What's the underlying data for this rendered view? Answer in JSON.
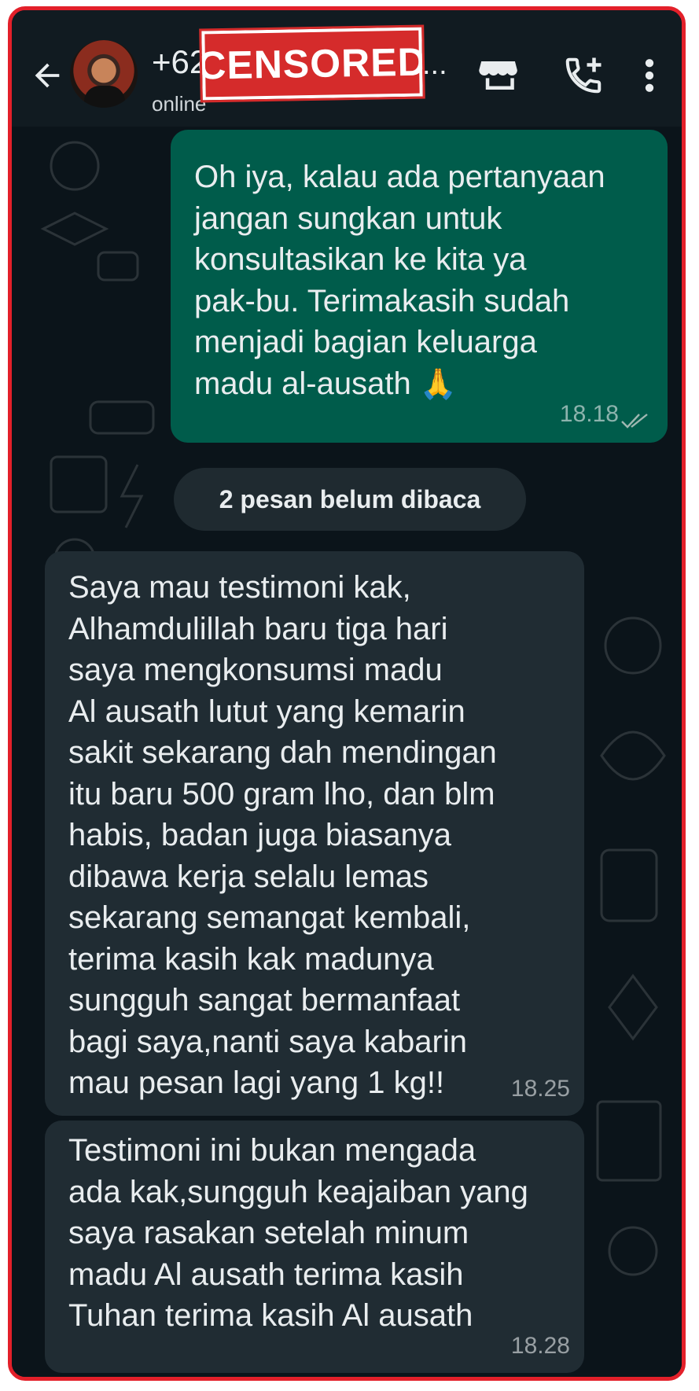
{
  "header": {
    "contact_name": "+62",
    "contact_name_tail": "...",
    "status": "online",
    "censor_label": "CENSORED",
    "icons": [
      "back-arrow-icon",
      "avatar",
      "store-icon",
      "add-call-icon",
      "more-vertical-icon"
    ]
  },
  "messages": [
    {
      "direction": "outgoing",
      "text": "Oh iya, kalau ada pertanyaan\njangan sungkan untuk\nkonsultasikan ke kita ya\npak-bu. Terimakasih sudah\nmenjadi bagian keluarga\nmadu al-ausath",
      "emoji": "🙏",
      "time": "18.18",
      "status": "read"
    },
    {
      "direction": "incoming",
      "text": "Saya mau testimoni kak,\nAlhamdulillah baru tiga hari\nsaya mengkonsumsi madu\nAl ausath lutut yang kemarin\nsakit sekarang dah mendingan\nitu baru 500 gram lho, dan blm\nhabis, badan juga biasanya\ndibawa kerja selalu lemas\nsekarang semangat kembali,\nterima kasih kak madunya\nsungguh sangat bermanfaat\nbagi saya,nanti saya kabarin\nmau pesan lagi yang 1 kg!!",
      "time": "18.25"
    },
    {
      "direction": "incoming",
      "text": "Testimoni ini bukan mengada\nada kak,sungguh keajaiban yang\nsaya rasakan setelah minum\nmadu Al ausath terima kasih\nTuhan terima kasih Al ausath",
      "time": "18.28"
    }
  ],
  "unread_divider": "2 pesan belum dibaca",
  "colors": {
    "frame_border": "#e3202a",
    "header_bg": "#111b21",
    "chat_bg": "#0b141a",
    "outgoing_bubble": "#005c4b",
    "incoming_bubble": "#202c33",
    "read_ticks": "#53bdeb"
  }
}
